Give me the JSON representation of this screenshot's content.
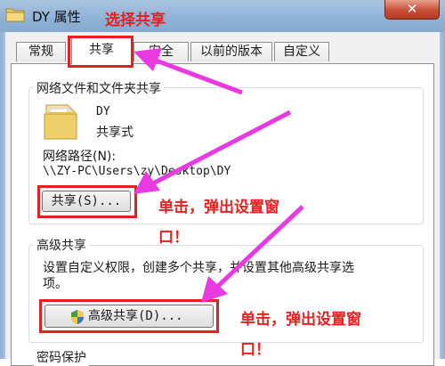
{
  "window": {
    "title": "DY 属性",
    "close_glyph": "✕"
  },
  "tabs": [
    {
      "label": "常规"
    },
    {
      "label": "共享"
    },
    {
      "label": "安全"
    },
    {
      "label": "以前的版本"
    },
    {
      "label": "自定义"
    }
  ],
  "network_sharing": {
    "group_title": "网络文件和文件夹共享",
    "folder_name": "DY",
    "folder_status": "共享式",
    "path_label": "网络路径(N):",
    "path_value": "\\\\ZY-PC\\Users\\zy\\Desktop\\DY",
    "share_button": "共享(S)..."
  },
  "advanced_sharing": {
    "group_title": "高级共享",
    "description_line1": "设置自定义权限，创建多个共享，并设置其他高级共享选",
    "description_line2": "项。",
    "button": "高级共享(D)..."
  },
  "password_protection": {
    "group_title": "密码保护"
  },
  "annotations": {
    "select_share": "选择共享",
    "click_popup_1_line1": "单击，弹出设置窗",
    "click_popup_1_line2": "口！",
    "click_popup_2_line1": "单击，弹出设置窗",
    "click_popup_2_line2": "口！"
  },
  "colors": {
    "annotation_red": "#e32121",
    "arrow_magenta": "#e83ae0",
    "titlebar_blue": "#9dbbdc"
  },
  "icons": [
    "folder-icon",
    "shield-icon",
    "close-icon"
  ]
}
